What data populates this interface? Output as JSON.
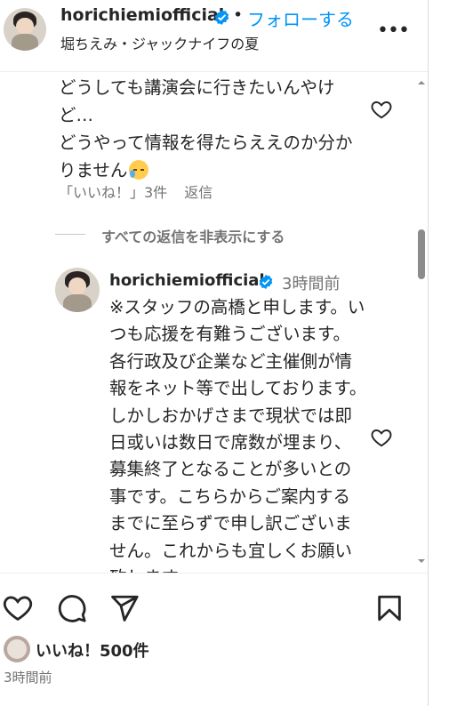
{
  "header": {
    "username": "horichiemiofficial",
    "separator": "•",
    "follow_label": "フォローする",
    "subtitle": "堀ちえみ・ジャックナイフの夏",
    "more_label": "•••"
  },
  "comments": {
    "first": {
      "text": "どうしても講演会に行きたいんやけど…\nどうやって情報を得たらええのか分かりません",
      "emoji": "downcast-face-with-sweat-emoji",
      "likes": "「いいね！」3件",
      "reply_label": "返信"
    },
    "hide_replies_label": "すべての返信を非表示にする",
    "reply": {
      "username": "horichiemiofficial",
      "time": "3時間前",
      "text": "※スタッフの高橋と申します。いつも応援を有難うございます。各行政及び企業など主催側が情報をネット等で出しております。しかしおかげさまで現状では即日或いは数日で席数が埋まり、募集終了となることが多いとの事です。こちらからご案内するまでに至らずで申し訳ございません。これからも宜しくお願い致します。"
    }
  },
  "actions": {
    "like_icon": "heart-icon",
    "comment_icon": "comment-icon",
    "share_icon": "send-icon",
    "save_icon": "bookmark-icon"
  },
  "footer": {
    "likes": "いいね！500件",
    "time": "3時間前"
  },
  "colors": {
    "accent": "#0095f6",
    "verified": "#0095f6",
    "text": "#262626",
    "secondary": "#737373"
  }
}
